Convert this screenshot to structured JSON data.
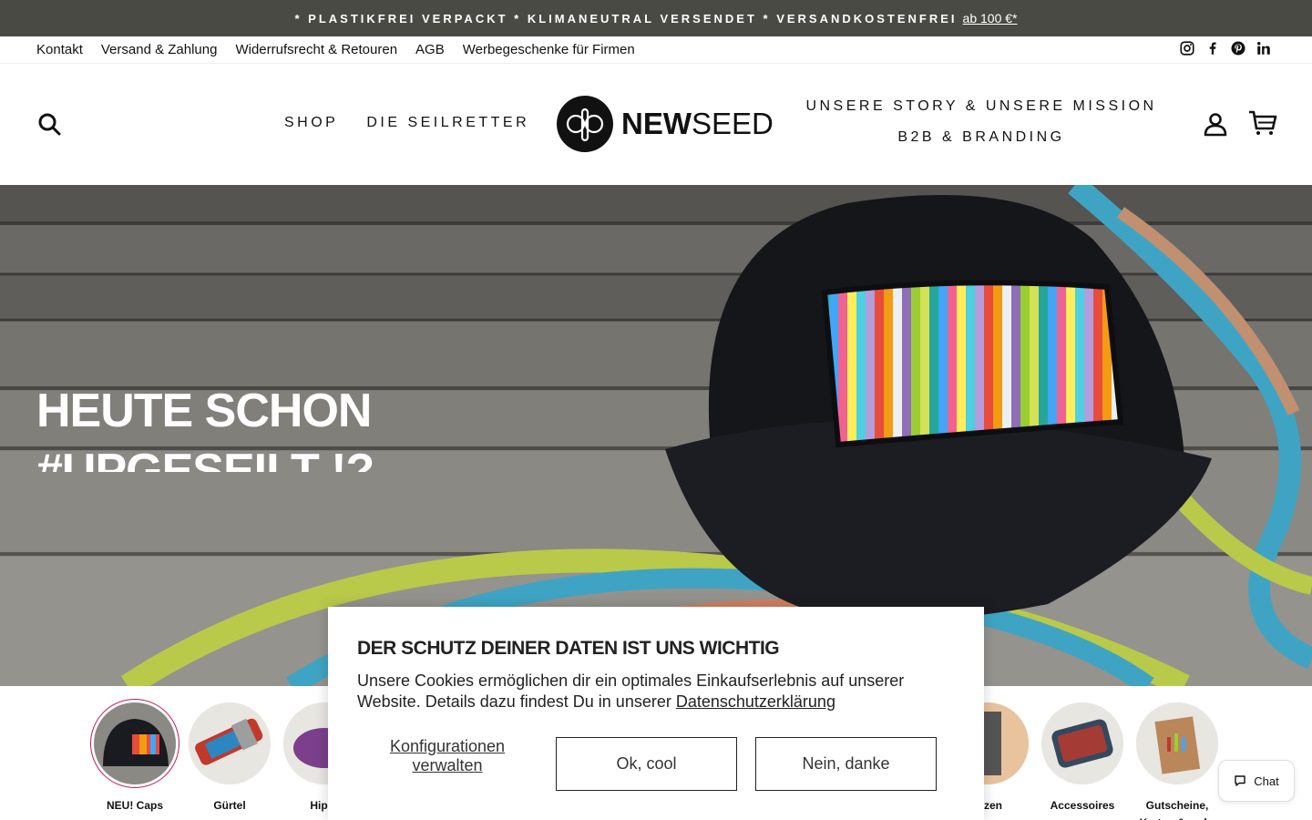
{
  "announcement": {
    "text": "* PLASTIKFREI VERPACKT * KLIMANEUTRAL VERSENDET * VERSANDKOSTENFREI",
    "link": "ab 100 €*"
  },
  "utility_links": [
    "Kontakt",
    "Versand & Zahlung",
    "Widerrufsrecht & Retouren",
    "AGB",
    "Werbegeschenke für Firmen"
  ],
  "social_icons": [
    "instagram-icon",
    "facebook-icon",
    "pinterest-icon",
    "linkedin-icon"
  ],
  "header": {
    "nav_left": [
      "SHOP",
      "DIE SEILRETTER"
    ],
    "logo_bold": "NEW",
    "logo_regular": "SEED",
    "nav_right": [
      "UNSERE STORY & UNSERE MISSION",
      "B2B & BRANDING"
    ]
  },
  "hero": {
    "title_line1": "HEUTE SCHON",
    "title_line2": "#UPGESEILT !?"
  },
  "categories": [
    {
      "label": "NEU! Caps",
      "active": true
    },
    {
      "label": "Gürtel"
    },
    {
      "label": "Hip B"
    },
    {
      "label": "ürzen"
    },
    {
      "label": "Accessoires"
    },
    {
      "label": "Gutscheine, Karten & mehr"
    }
  ],
  "cookie": {
    "title": "DER SCHUTZ DEINER DATEN IST UNS WICHTIG",
    "text": "Unsere Cookies ermöglichen dir ein optimales Einkaufserlebnis auf unserer Website. Details dazu findest Du in unserer",
    "link": "Datenschutzerklärung",
    "config_label": "Konfigurationen verwalten",
    "ok_label": "Ok, cool",
    "no_label": "Nein, danke"
  },
  "chat": {
    "label": "Chat"
  },
  "colors": {
    "announcement_bg": "#4a4a44",
    "accent": "#c2185b"
  }
}
